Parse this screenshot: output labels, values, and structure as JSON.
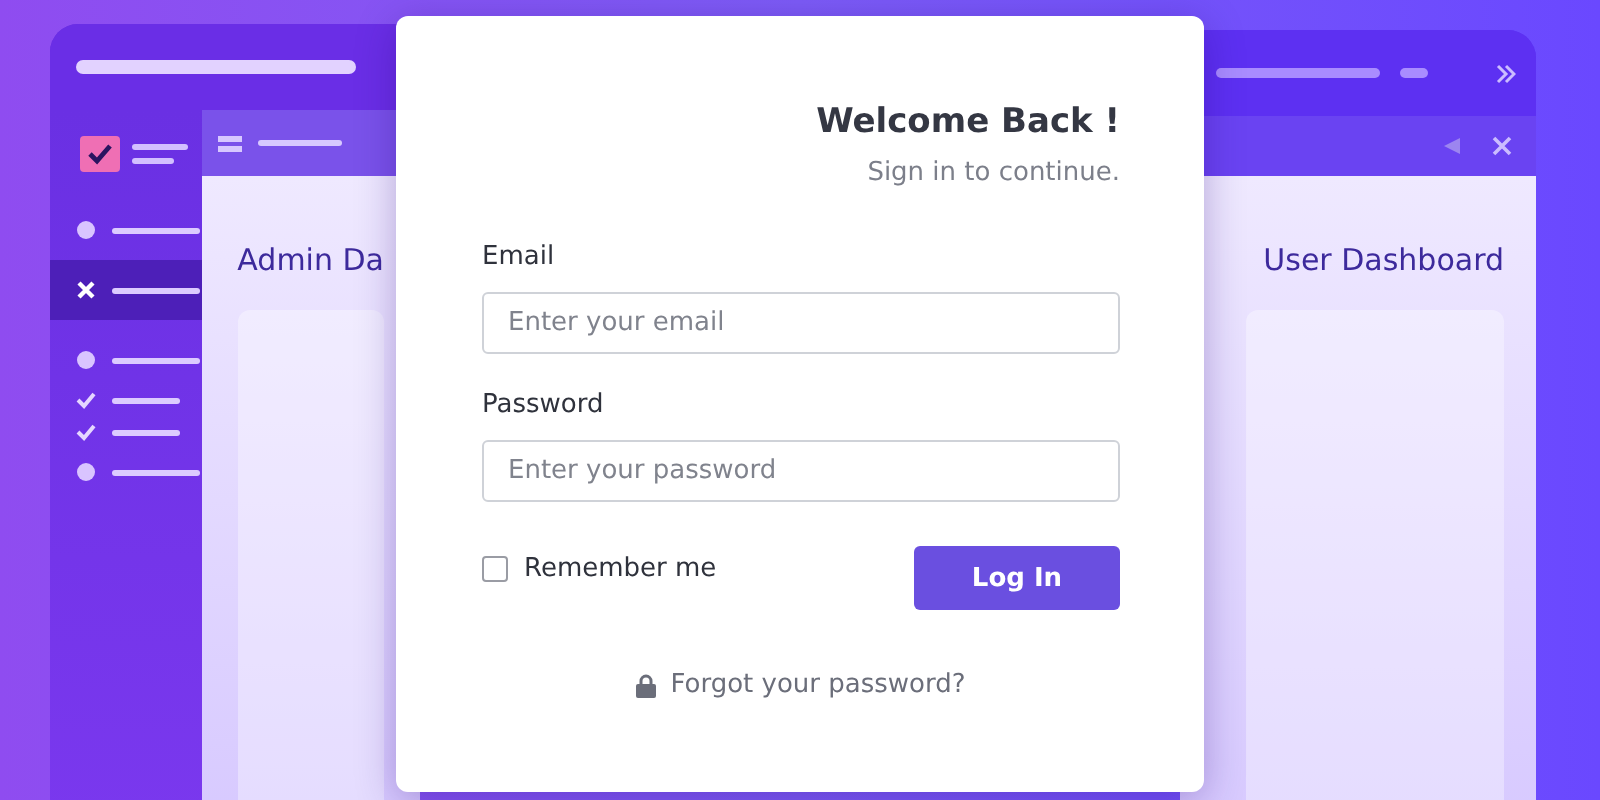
{
  "left_window": {
    "sidebar": {
      "items": [
        {
          "kind": "dot",
          "selected": false
        },
        {
          "kind": "cross",
          "selected": true
        },
        {
          "kind": "dot",
          "selected": false
        },
        {
          "kind": "check",
          "selected": false
        },
        {
          "kind": "check",
          "selected": false
        },
        {
          "kind": "dot",
          "selected": false
        }
      ]
    },
    "heading": "Admin Da"
  },
  "right_window": {
    "heading": "User Dashboard"
  },
  "login": {
    "title": "Welcome Back !",
    "subtitle": "Sign in to continue.",
    "fields": [
      {
        "label": "Email",
        "placeholder": "Enter your email"
      },
      {
        "label": "Password",
        "placeholder": "Enter your password"
      }
    ],
    "remember": {
      "label": "Remember me",
      "checked": false
    },
    "button": "Log In",
    "forgot": "Forgot your password?"
  }
}
